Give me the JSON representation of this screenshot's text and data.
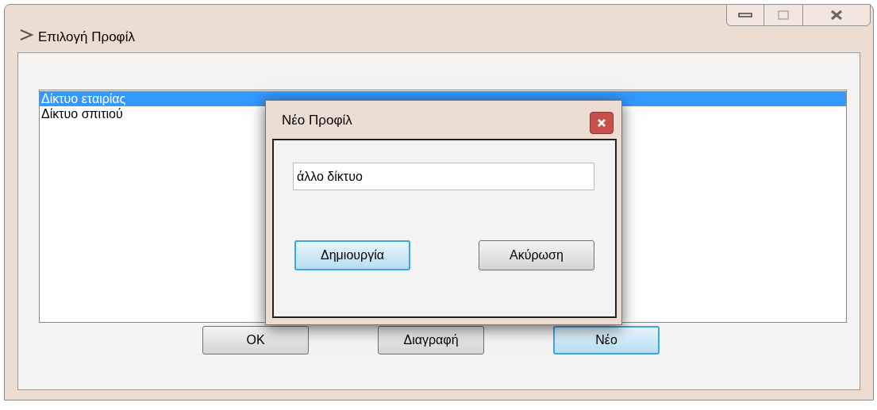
{
  "window": {
    "title": "Επιλογή Προφίλ"
  },
  "profiles": [
    {
      "label": "Δίκτυο εταιρίας",
      "selected": true
    },
    {
      "label": "Δίκτυο σπιτιού",
      "selected": false
    }
  ],
  "buttons": [
    {
      "label": "OK",
      "focused": false
    },
    {
      "label": "Διαγραφή",
      "focused": false
    },
    {
      "label": "Νέο",
      "focused": true
    }
  ],
  "dialog": {
    "title": "Νέο Προφίλ",
    "name_field": {
      "value": "άλλο δίκτυο"
    },
    "buttons": [
      {
        "label": "Δημιουργία",
        "focused": true
      },
      {
        "label": "Ακύρωση",
        "focused": false
      }
    ]
  }
}
